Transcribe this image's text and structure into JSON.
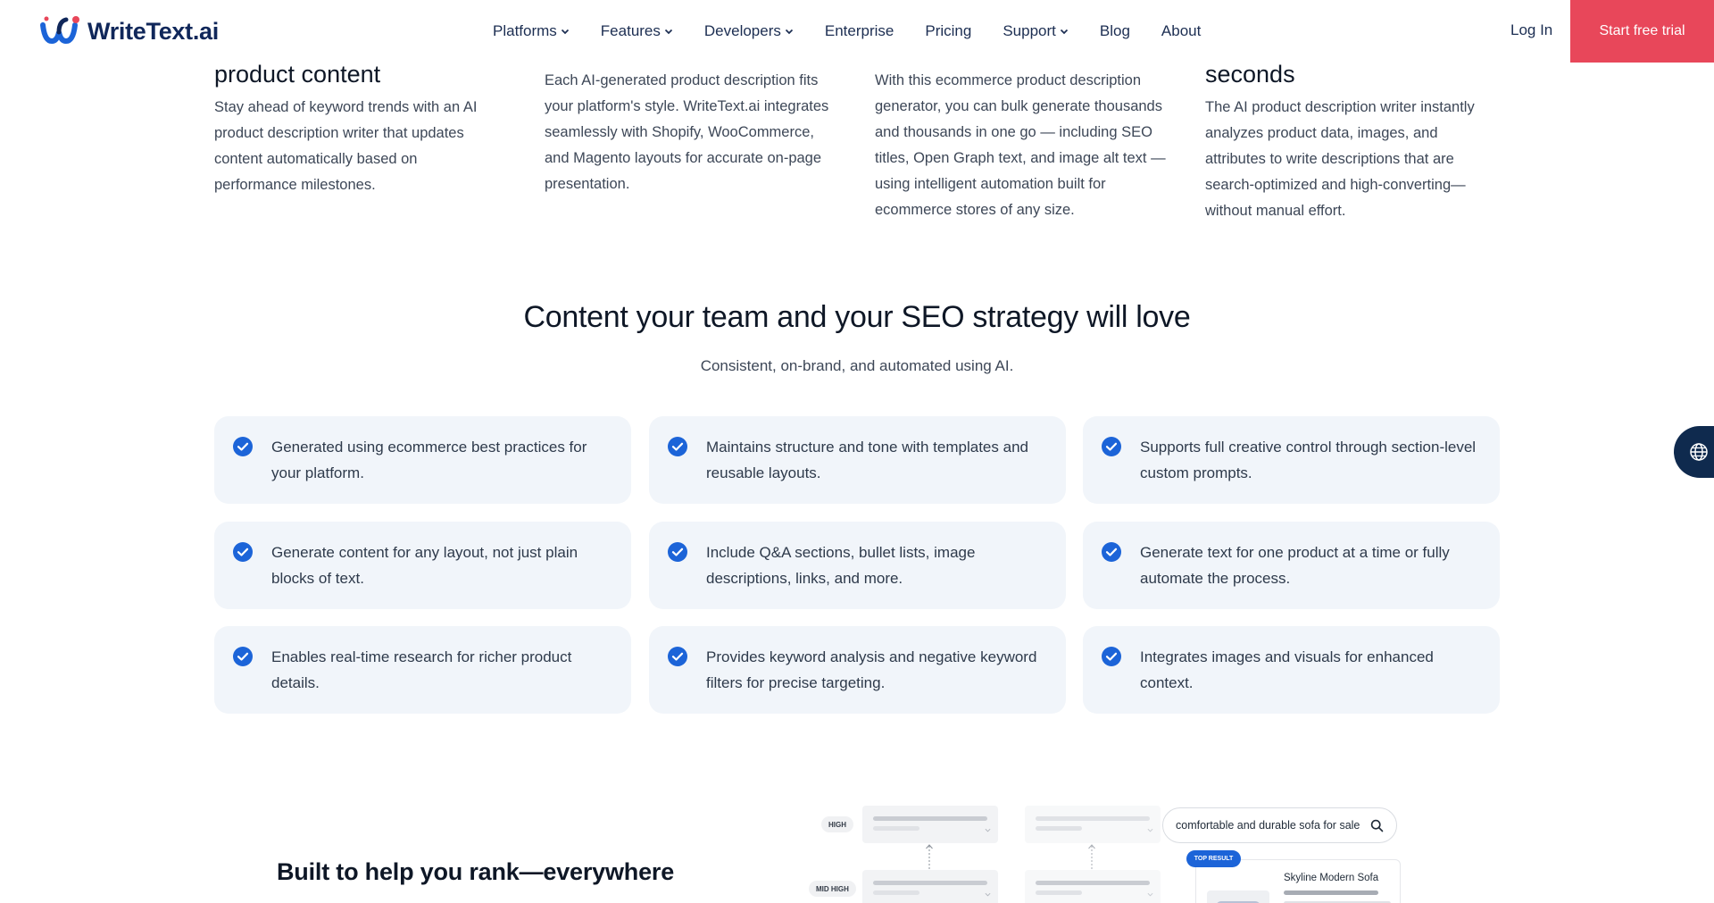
{
  "header": {
    "logo_text": "WriteText.ai",
    "nav": [
      {
        "label": "Platforms",
        "dropdown": true
      },
      {
        "label": "Features",
        "dropdown": true
      },
      {
        "label": "Developers",
        "dropdown": true
      },
      {
        "label": "Enterprise",
        "dropdown": false
      },
      {
        "label": "Pricing",
        "dropdown": false
      },
      {
        "label": "Support",
        "dropdown": true
      },
      {
        "label": "Blog",
        "dropdown": false
      },
      {
        "label": "About",
        "dropdown": false
      }
    ],
    "login_label": "Log In",
    "trial_label": "Start free trial"
  },
  "columns": [
    {
      "title": "product content",
      "text": "Stay ahead of keyword trends with an AI product description writer that updates content automatically based on performance milestones."
    },
    {
      "title": "",
      "text": "Each AI-generated product description fits your platform's style. WriteText.ai integrates seamlessly with Shopify, WooCommerce, and Magento layouts for accurate on-page presentation."
    },
    {
      "title": "",
      "text": "With this ecommerce product description generator, you can bulk generate thousands and thousands in one go — including SEO titles, Open Graph text, and image alt text — using intelligent automation built for ecommerce stores of any size."
    },
    {
      "title": "seconds",
      "text": "The AI product description writer instantly analyzes product data, images, and attributes to write descriptions that are search-optimized and high-converting—without manual effort."
    }
  ],
  "section": {
    "title": "Content your team and your SEO strategy will love",
    "subtitle": "Consistent, on-brand, and automated using AI.",
    "features": [
      "Generated using ecommerce best practices for your platform.",
      "Maintains structure and tone with templates and reusable layouts.",
      "Supports full creative control through section-level custom prompts.",
      "Generate content for any layout, not just plain blocks of text.",
      "Include Q&A sections, bullet lists, image descriptions, links, and more.",
      "Generate text for one product at a time or fully automate the process.",
      "Enables real-time research for richer product details.",
      "Provides keyword analysis and negative keyword filters for precise targeting.",
      "Integrates images and visuals for enhanced context."
    ]
  },
  "rank": {
    "title": "Built to help you rank—everywhere",
    "pill_high": "HIGH",
    "pill_mid_high": "MID HIGH",
    "search_text": "comfortable and durable sofa for sale",
    "top_result_label": "TOP RESULT",
    "product_name": "Skyline Modern Sofa"
  },
  "colors": {
    "brand_navy": "#10275a",
    "accent_red": "#e8475a",
    "check_blue": "#1c64d8",
    "card_bg": "#f1f5fa"
  },
  "icons": {
    "check": "check-circle-icon",
    "globe": "globe-icon",
    "search": "search-icon",
    "chevron": "chevron-down-icon"
  }
}
